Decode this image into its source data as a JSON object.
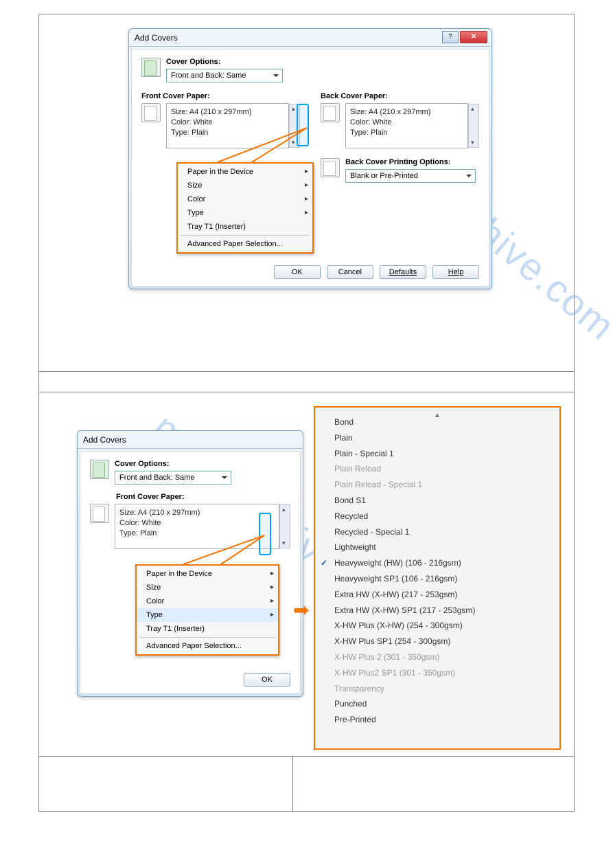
{
  "watermark": "manualshive.com",
  "dialog1": {
    "title": "Add Covers",
    "cover_options_label": "Cover Options:",
    "cover_options_value": "Front and Back: Same",
    "front_label": "Front Cover Paper:",
    "back_label": "Back Cover Paper:",
    "paper_size": "Size: A4 (210 x 297mm)",
    "paper_color": "Color: White",
    "paper_type": "Type: Plain",
    "back_print_label": "Back Cover Printing Options:",
    "back_print_value": "Blank or Pre-Printed",
    "buttons": {
      "ok": "OK",
      "cancel": "Cancel",
      "defaults": "Defaults",
      "help": "Help"
    },
    "menu": {
      "paper_in_device": "Paper in the Device",
      "size": "Size",
      "color": "Color",
      "type": "Type",
      "tray": "Tray T1 (Inserter)",
      "advanced": "Advanced Paper Selection..."
    }
  },
  "dialog2": {
    "title": "Add Covers",
    "cover_options_label": "Cover Options:",
    "cover_options_value": "Front and Back: Same",
    "front_label": "Front Cover Paper:",
    "paper_size": "Size: A4 (210 x 297mm)",
    "paper_color": "Color: White",
    "paper_type": "Type: Plain",
    "buttons": {
      "ok": "OK"
    },
    "menu": {
      "paper_in_device": "Paper in the Device",
      "size": "Size",
      "color": "Color",
      "type": "Type",
      "tray": "Tray T1 (Inserter)",
      "advanced": "Advanced Paper Selection..."
    }
  },
  "type_list": [
    {
      "t": "Bond"
    },
    {
      "t": "Plain"
    },
    {
      "t": "Plain - Special 1"
    },
    {
      "t": "Plain Reload",
      "dis": true
    },
    {
      "t": "Plain Reload - Special 1",
      "dis": true
    },
    {
      "t": "Bond S1"
    },
    {
      "t": "Recycled"
    },
    {
      "t": "Recycled - Special 1"
    },
    {
      "t": "Lightweight"
    },
    {
      "t": "Heavyweight (HW) (106 - 216gsm)",
      "chk": true
    },
    {
      "t": "Heavyweight SP1 (106 - 216gsm)"
    },
    {
      "t": "Extra HW (X-HW) (217 - 253gsm)"
    },
    {
      "t": "Extra HW (X-HW) SP1 (217 - 253gsm)"
    },
    {
      "t": "X-HW Plus (X-HW) (254 - 300gsm)"
    },
    {
      "t": "X-HW Plus SP1 (254 - 300gsm)"
    },
    {
      "t": "X-HW Plus 2 (301 - 350gsm)",
      "dis": true
    },
    {
      "t": "X-HW Plus2 SP1 (301 - 350gsm)",
      "dis": true
    },
    {
      "t": "Transparency",
      "dis": true
    },
    {
      "t": "Punched"
    },
    {
      "t": "Pre-Printed"
    }
  ]
}
